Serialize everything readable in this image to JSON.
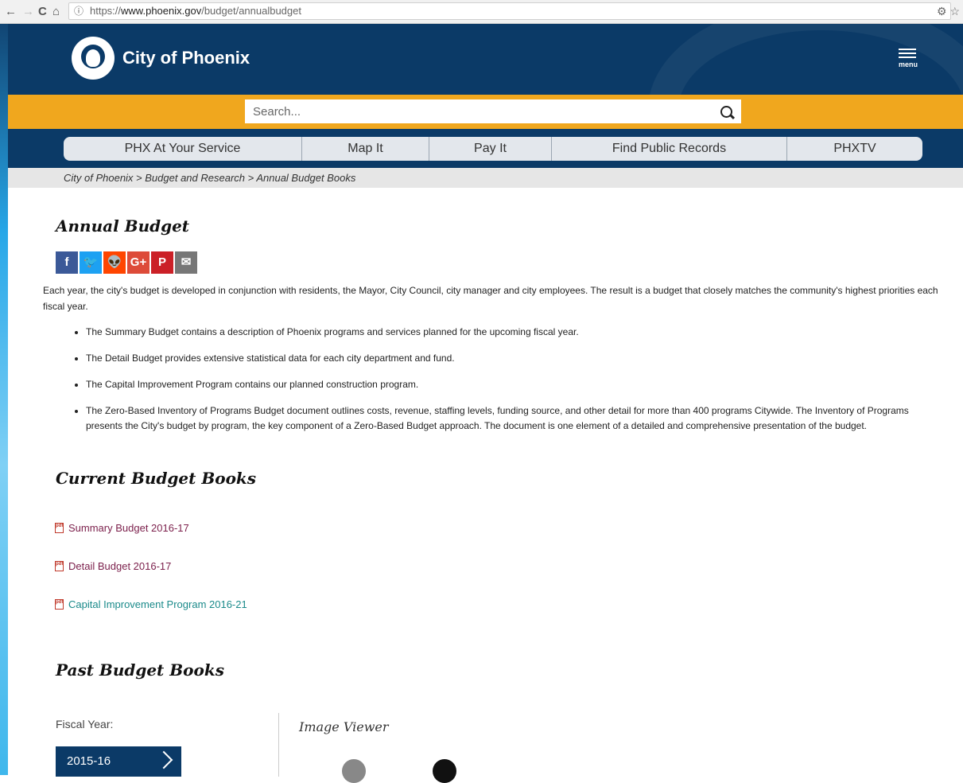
{
  "browser": {
    "back": "←",
    "forward": "→",
    "reload": "C",
    "home": "⌂",
    "info": "ⓘ",
    "url_prefix": "https://",
    "url_host": "www.phoenix.gov",
    "url_path": "/budget/annualbudget",
    "right_icons": "⚙ ☆"
  },
  "header": {
    "site_name": "City of Phoenix",
    "menu_label": "menu"
  },
  "search": {
    "placeholder": "Search..."
  },
  "nav": {
    "items": [
      "PHX At Your Service",
      "Map It",
      "Pay It",
      "Find Public Records",
      "PHXTV"
    ]
  },
  "breadcrumb": "City of Phoenix > Budget and Research > Annual Budget Books",
  "page": {
    "title": "Annual Budget",
    "social": [
      {
        "icon": "facebook-icon",
        "glyph": "f",
        "color": "#3b5998"
      },
      {
        "icon": "twitter-icon",
        "glyph": "🐦",
        "color": "#1da1f2"
      },
      {
        "icon": "reddit-icon",
        "glyph": "👽",
        "color": "#ff4500"
      },
      {
        "icon": "google-plus-icon",
        "glyph": "G+",
        "color": "#dd4b39"
      },
      {
        "icon": "pinterest-icon",
        "glyph": "P",
        "color": "#cb2027"
      },
      {
        "icon": "email-icon",
        "glyph": "✉",
        "color": "#777777"
      }
    ],
    "intro": "Each year, the city's budget is developed in conjunction with residents, the Mayor, City Council, city manager and city employees. The result is a budget that closely matches the community's highest priorities each fiscal year.",
    "bullets": [
      "The Summary Budget contains a description of Phoenix programs and services planned for the upcoming fiscal year.",
      "The Detail Budget provides extensive statistical data for each city department and fund.",
      "The Capital Improvement Program contains our planned construction program.",
      "The Zero-Based Inventory of Programs Budget document outlines costs, revenue, staffing levels, funding source, and other detail for more than 400 programs Citywide. The Inventory of Programs presents the City's budget by program, the key component of a Zero-Based Budget approach. The document is one element of a detailed and comprehensive presentation of the budget."
    ],
    "current_heading": "Current Budget Books",
    "current_books": [
      {
        "label": "Summary Budget 2016-17",
        "color": "#7b1f4b"
      },
      {
        "label": "Detail Budget 2016-17",
        "color": "#7b1f4b"
      },
      {
        "label": "Capital Improvement Program 2016-21",
        "color": "#1a8a8a"
      }
    ],
    "pdf_icon_text": "pdf",
    "past_heading": "Past Budget Books",
    "fiscal_year_label": "Fiscal Year:",
    "fiscal_year_selected": "2015-16",
    "viewer_title": "Image Viewer"
  },
  "colors": {
    "header": "#0b3a67",
    "search_strip": "#f0a71e",
    "nav_bar": "#e3e7ec",
    "breadcrumb_bg": "#e6e6e6"
  }
}
